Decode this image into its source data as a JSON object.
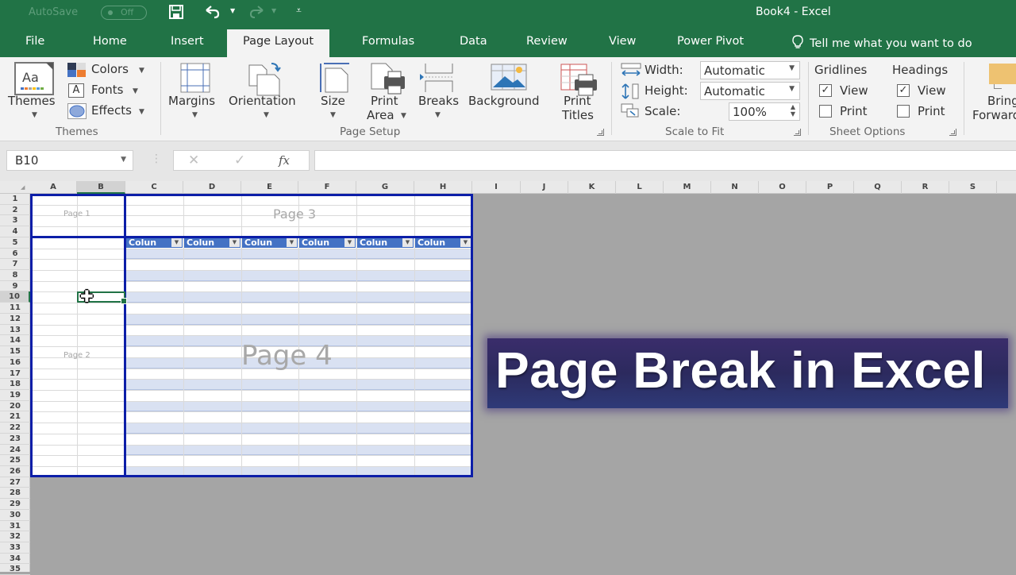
{
  "titlebar": {
    "autosave_label": "AutoSave",
    "autosave_state": "Off",
    "doc_title": "Book4  -  Excel"
  },
  "tabs": [
    {
      "label": "File"
    },
    {
      "label": "Home"
    },
    {
      "label": "Insert"
    },
    {
      "label": "Page Layout",
      "active": true
    },
    {
      "label": "Formulas"
    },
    {
      "label": "Data"
    },
    {
      "label": "Review"
    },
    {
      "label": "View"
    },
    {
      "label": "Power Pivot"
    }
  ],
  "tellme": "Tell me what you want to do",
  "ribbon": {
    "themes_group": {
      "label": "Themes",
      "themes_btn": "Themes",
      "colors_btn": "Colors",
      "fonts_btn": "Fonts",
      "effects_btn": "Effects"
    },
    "page_setup_group": {
      "label": "Page Setup",
      "margins": "Margins",
      "orientation": "Orientation",
      "size": "Size",
      "print_area_1": "Print",
      "print_area_2": "Area",
      "breaks": "Breaks",
      "background": "Background",
      "print_titles_1": "Print",
      "print_titles_2": "Titles"
    },
    "scale_group": {
      "label": "Scale to Fit",
      "width_label": "Width:",
      "width_value": "Automatic",
      "height_label": "Height:",
      "height_value": "Automatic",
      "scale_label": "Scale:",
      "scale_value": "100%"
    },
    "sheet_options_group": {
      "label": "Sheet Options",
      "gridlines": "Gridlines",
      "headings": "Headings",
      "view": "View",
      "print": "Print",
      "gridlines_view_checked": true,
      "gridlines_print_checked": false,
      "headings_view_checked": true,
      "headings_print_checked": false
    },
    "arrange_group": {
      "bring_forward_1": "Bring",
      "bring_forward_2": "Forward"
    }
  },
  "formula_bar": {
    "name_box": "B10",
    "cancel_icon": "✕",
    "enter_icon": "✓",
    "fx_label": "fx",
    "formula_value": ""
  },
  "grid": {
    "columns": [
      "A",
      "B",
      "C",
      "D",
      "E",
      "F",
      "G",
      "H",
      "I",
      "J",
      "K",
      "L",
      "M",
      "N",
      "O",
      "P",
      "Q",
      "R",
      "S"
    ],
    "selected_column": "B",
    "rows": [
      "1",
      "2",
      "3",
      "4",
      "5",
      "6",
      "7",
      "8",
      "9",
      "10",
      "11",
      "12",
      "13",
      "14",
      "15",
      "16",
      "17",
      "18",
      "19",
      "20",
      "21",
      "22",
      "23",
      "24",
      "25",
      "26",
      "27",
      "28",
      "29",
      "30",
      "31",
      "32",
      "33",
      "34",
      "35"
    ],
    "selected_row": "10",
    "table_header_text": "Colun",
    "page_labels": {
      "page1": "Page 1",
      "page2": "Page 2",
      "page3": "Page 3",
      "page4": "Page 4"
    }
  },
  "banner": {
    "text": "Page Break in Excel"
  }
}
